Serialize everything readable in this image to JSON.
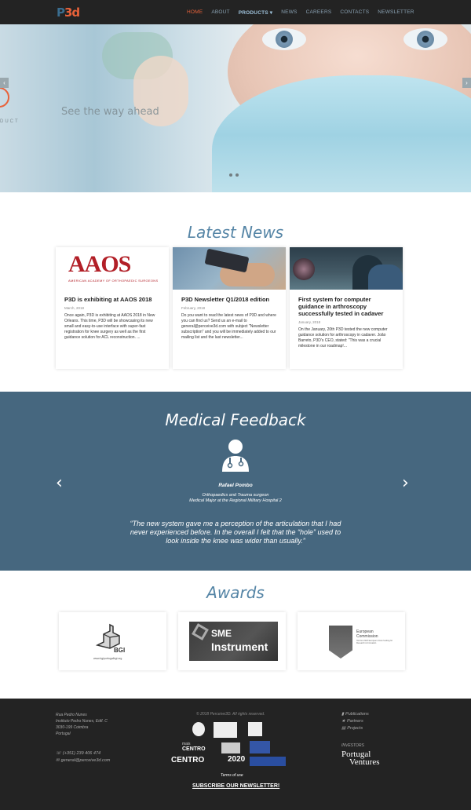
{
  "nav": {
    "logo": "P3d",
    "items": [
      {
        "label": "HOME",
        "active": true
      },
      {
        "label": "ABOUT"
      },
      {
        "label": "PRODUCTS ▾"
      },
      {
        "label": "NEWS"
      },
      {
        "label": "CAREERS"
      },
      {
        "label": "CONTACTS"
      },
      {
        "label": "NEWSLETTER"
      }
    ]
  },
  "hero": {
    "tagline": "See the way ahead",
    "fragment": "DUCT",
    "prev": "‹",
    "next": "›"
  },
  "news": {
    "title": "Latest News",
    "cards": [
      {
        "image_text": "AAOS",
        "image_sub": "AMERICAN ACADEMY OF ORTHOPAEDIC SURGEONS",
        "title": "P3D is exhibiting at AAOS 2018",
        "date": "March, 2018",
        "text": "Once again, P3D is exhibiting at AAOS 2018 in New Orleans. This time, P3D will be showcasing its new small and easy-to-use interface with super-fast registration for knee surgery as well as the first guidance solution for ACL reconstruction. ..."
      },
      {
        "title": "P3D Newsletter Q1/2018 edition",
        "date": "February, 2018",
        "text": "Do you want to read the latest news of P3D and where you can find us? Send us an e-mail to general@perceive3d.com with subject \"Newsletter subscription\" and you will be immediately added to our mailing list and the last newsletter..."
      },
      {
        "title": "First system for computer guidance in arthroscopy successfully tested in cadaver",
        "date": "January, 2018",
        "text": "On the January, 20th P3D tested the new computer guidance solution for arthroscopy in cadaver. João Barreto, P3D's CEO, stated: \"This was a crucial milestone in our roadmap!..."
      }
    ]
  },
  "feedback": {
    "title": "Medical Feedback",
    "name": "Rafael Pombo",
    "role1": "Orthopaedics and Trauma surgeon",
    "role2": "Medical Major at the Regional Military Hospital 2",
    "quote": "“The new system gave me a perception of the articulation that I had never experienced before. In the overall I felt that the “hole” used to look inside the knee was wider than usually.”",
    "prev": "‹",
    "next": "›"
  },
  "awards": {
    "title": "Awards",
    "bgi": "BGI",
    "bgi_url": "www.bgiportugalbgi.org",
    "sme1": "SME",
    "sme2": "Instrument",
    "ec_title": "European\nCommission",
    "ec_sub": "Horizon 2020 European Union funding for Research & Innovation"
  },
  "footer": {
    "address": [
      "Rua Pedro Nunes",
      "Instituto Pedro Nunes, Edif. C",
      "3030-199 Coimbra",
      "Portugal"
    ],
    "phone": "(+351) 239 406 474",
    "email": "general@perceive3d.com",
    "copyright": "© 2018 Perceive3D. All rights reserved.",
    "terms": "Terms of use",
    "subscribe": "SUBSCRIBE OUR NEWSLETTER!",
    "links": [
      "Publications",
      "Partners",
      "Projects"
    ],
    "investors_label": "INVESTORS",
    "investor1": "Portugal",
    "investor2": "Ventures",
    "logo_texts": [
      "mais",
      "CENTRO",
      "2020"
    ]
  }
}
